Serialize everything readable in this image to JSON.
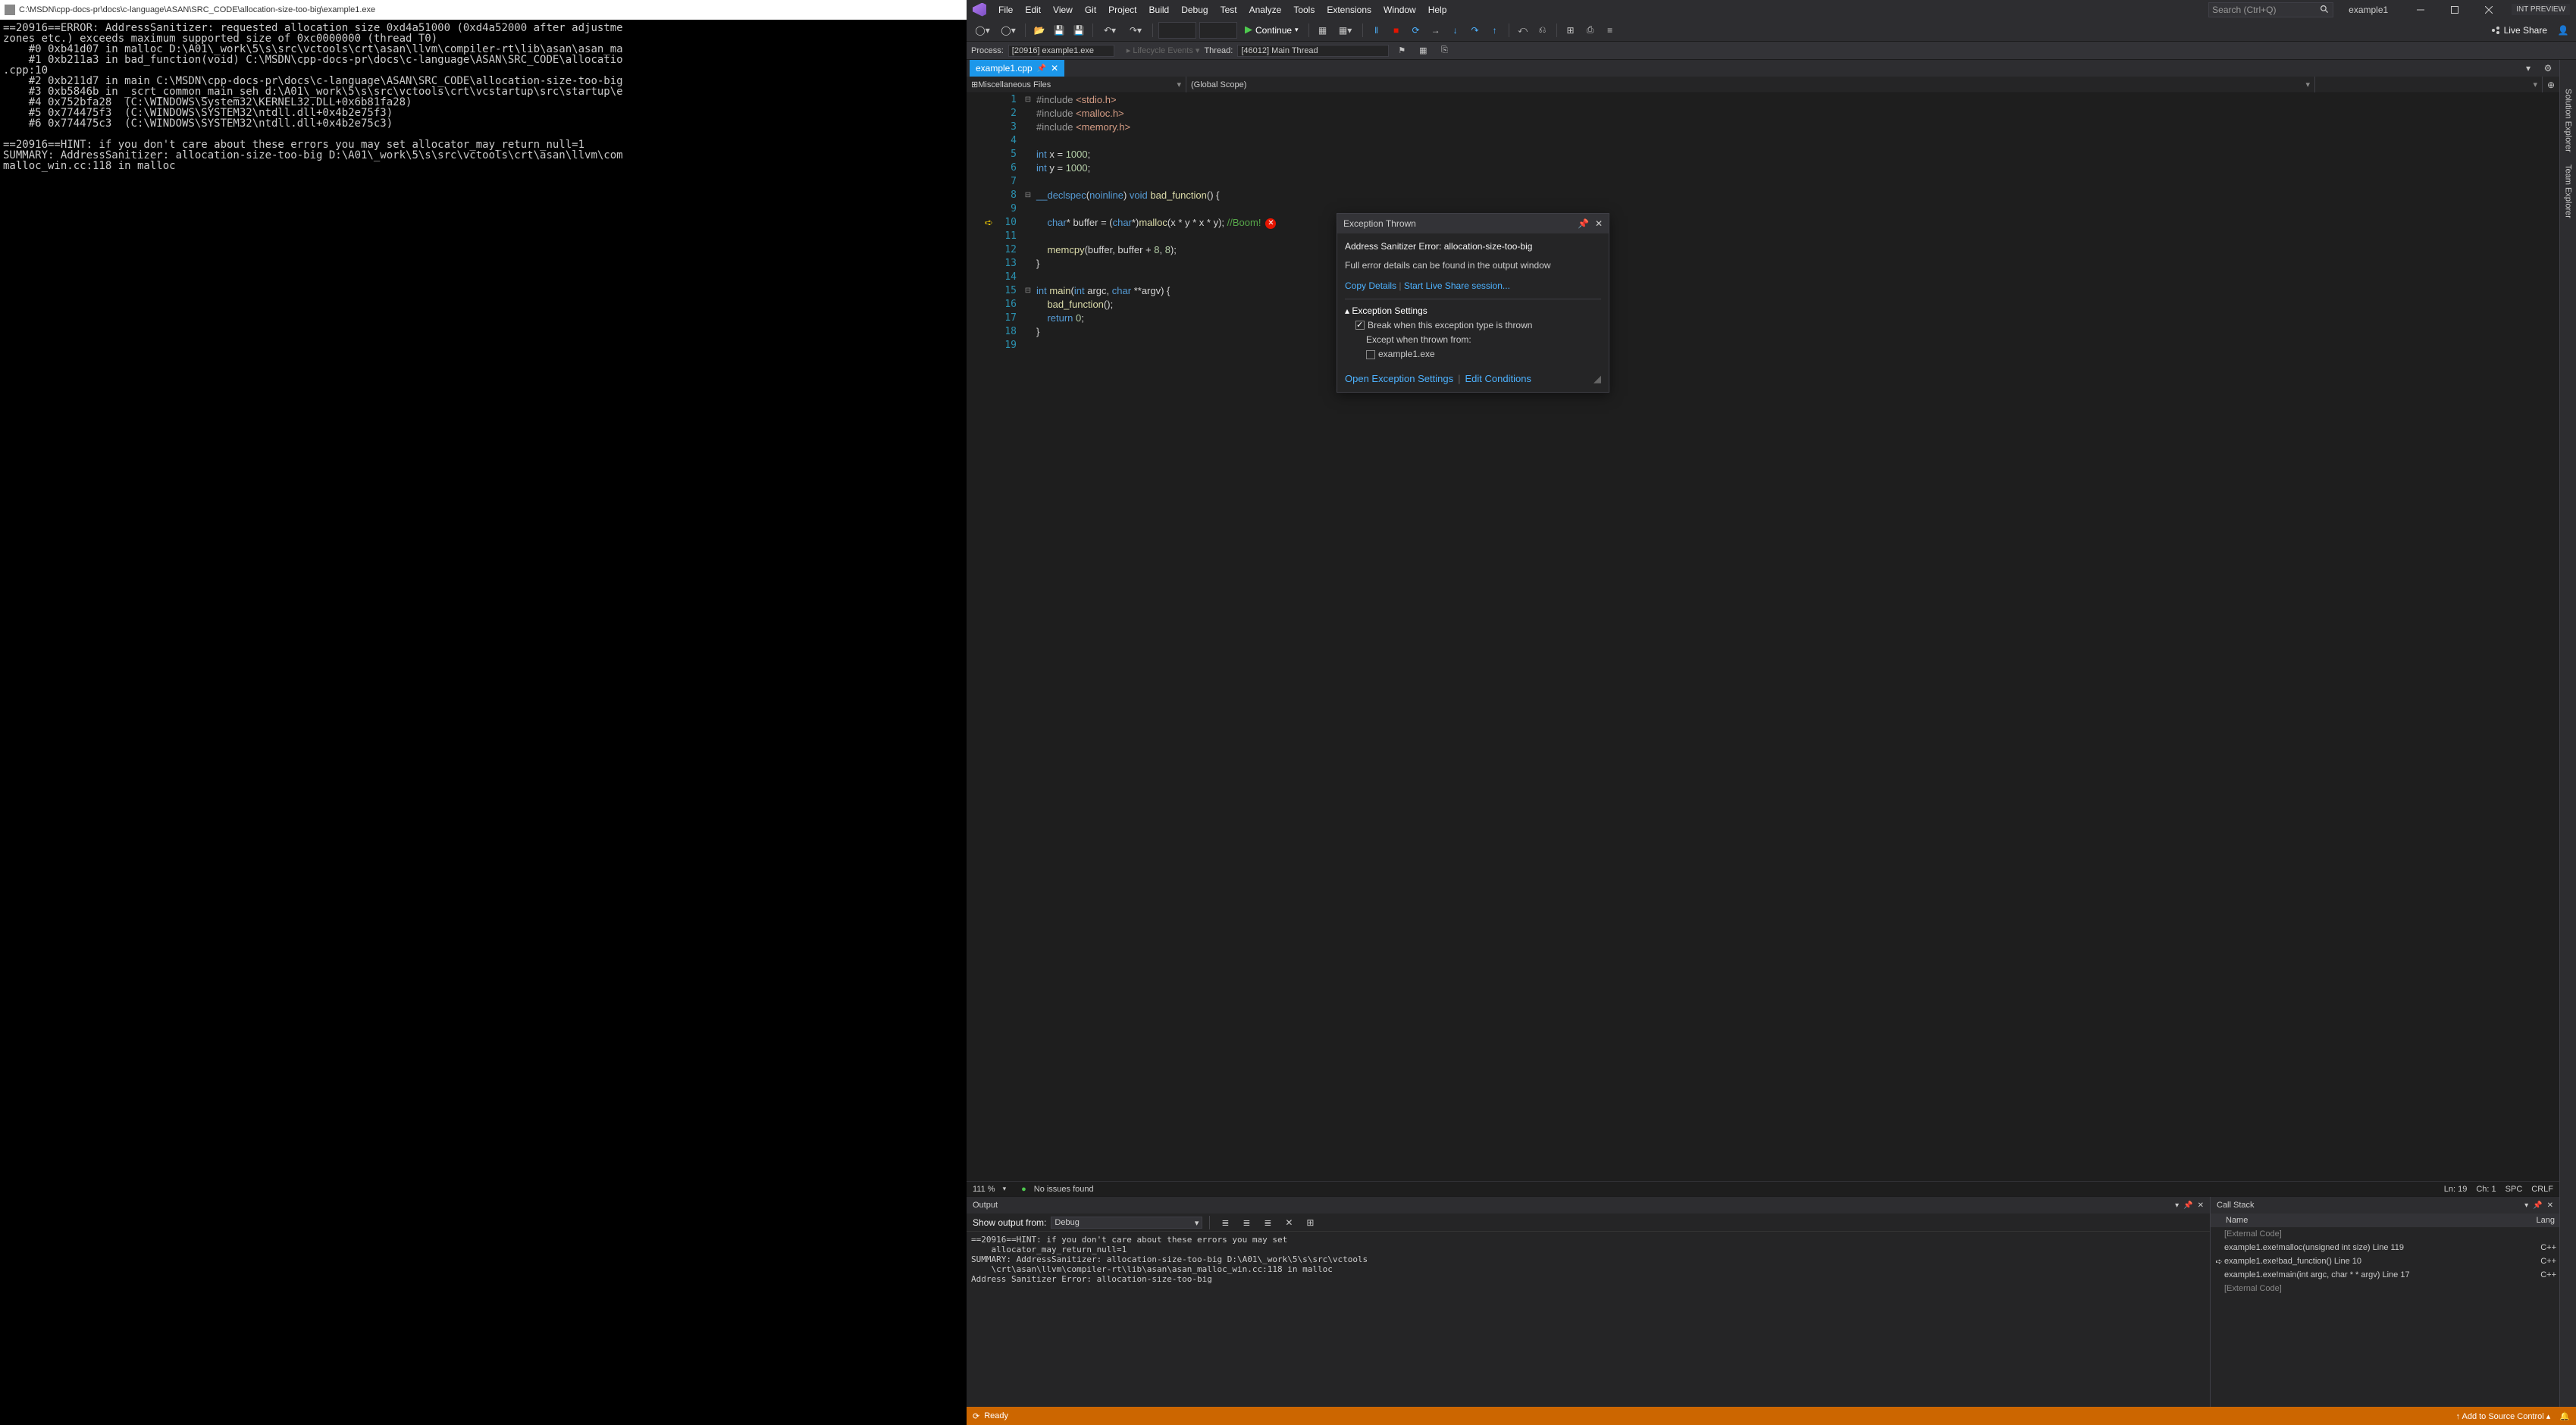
{
  "console": {
    "title": "C:\\MSDN\\cpp-docs-pr\\docs\\c-language\\ASAN\\SRC_CODE\\allocation-size-too-big\\example1.exe",
    "lines": [
      "==20916==ERROR: AddressSanitizer: requested allocation size 0xd4a51000 (0xd4a52000 after adjustme",
      "zones etc.) exceeds maximum supported size of 0xc0000000 (thread T0)",
      "    #0 0xb41d07 in malloc D:\\A01\\_work\\5\\s\\src\\vctools\\crt\\asan\\llvm\\compiler-rt\\lib\\asan\\asan_ma",
      "    #1 0xb211a3 in bad_function(void) C:\\MSDN\\cpp-docs-pr\\docs\\c-language\\ASAN\\SRC_CODE\\allocatio",
      ".cpp:10",
      "    #2 0xb211d7 in main C:\\MSDN\\cpp-docs-pr\\docs\\c-language\\ASAN\\SRC_CODE\\allocation-size-too-big",
      "    #3 0xb5846b in _scrt_common_main_seh d:\\A01\\_work\\5\\s\\src\\vctools\\crt\\vcstartup\\src\\startup\\e",
      "    #4 0x752bfa28  (C:\\WINDOWS\\System32\\KERNEL32.DLL+0x6b81fa28)",
      "    #5 0x774475f3  (C:\\WINDOWS\\SYSTEM32\\ntdll.dll+0x4b2e75f3)",
      "    #6 0x774475c3  (C:\\WINDOWS\\SYSTEM32\\ntdll.dll+0x4b2e75c3)",
      "",
      "==20916==HINT: if you don't care about these errors you may set allocator_may_return_null=1",
      "SUMMARY: AddressSanitizer: allocation-size-too-big D:\\A01\\_work\\5\\s\\src\\vctools\\crt\\asan\\llvm\\com",
      "malloc_win.cc:118 in malloc"
    ]
  },
  "menu": [
    "File",
    "Edit",
    "View",
    "Git",
    "Project",
    "Build",
    "Debug",
    "Test",
    "Analyze",
    "Tools",
    "Extensions",
    "Window",
    "Help"
  ],
  "search_placeholder": "Search (Ctrl+Q)",
  "solution_name": "example1",
  "int_preview": "INT PREVIEW",
  "continue_label": "Continue",
  "live_share": "Live Share",
  "process_label": "Process:",
  "process_value": "[20916] example1.exe",
  "lifecycle": "Lifecycle Events",
  "thread_label": "Thread:",
  "thread_value": "[46012] Main Thread",
  "tab_name": "example1.cpp",
  "nav1": "Miscellaneous Files",
  "nav2": "(Global Scope)",
  "code": {
    "lines": 19,
    "zoom": "111 %",
    "issues": "No issues found",
    "ln": "Ln: 19",
    "ch": "Ch: 1",
    "spc": "SPC",
    "crlf": "CRLF"
  },
  "exception": {
    "title": "Exception Thrown",
    "error": "Address Sanitizer Error: allocation-size-too-big",
    "detail": "Full error details can be found in the output window",
    "copy": "Copy Details",
    "start_share": "Start Live Share session...",
    "settings_hd": "Exception Settings",
    "break_label": "Break when this exception type is thrown",
    "except_label": "Except when thrown from:",
    "exe": "example1.exe",
    "open_settings": "Open Exception Settings",
    "edit_cond": "Edit Conditions"
  },
  "output": {
    "title": "Output",
    "show_from": "Show output from:",
    "source": "Debug",
    "body": "==20916==HINT: if you don't care about these errors you may set\n    allocator_may_return_null=1\nSUMMARY: AddressSanitizer: allocation-size-too-big D:\\A01\\_work\\5\\s\\src\\vctools\n    \\crt\\asan\\llvm\\compiler-rt\\lib\\asan\\asan_malloc_win.cc:118 in malloc\nAddress Sanitizer Error: allocation-size-too-big"
  },
  "callstack": {
    "title": "Call Stack",
    "col_name": "Name",
    "col_lang": "Lang",
    "rows": [
      {
        "name": "[External Code]",
        "lang": "",
        "ext": true,
        "ic": ""
      },
      {
        "name": "example1.exe!malloc(unsigned int size) Line 119",
        "lang": "C++",
        "ext": false,
        "ic": ""
      },
      {
        "name": "example1.exe!bad_function() Line 10",
        "lang": "C++",
        "ext": false,
        "ic": "➪"
      },
      {
        "name": "example1.exe!main(int argc, char * * argv) Line 17",
        "lang": "C++",
        "ext": false,
        "ic": ""
      },
      {
        "name": "[External Code]",
        "lang": "",
        "ext": true,
        "ic": ""
      }
    ]
  },
  "side_tabs": [
    "Solution Explorer",
    "Team Explorer"
  ],
  "status": {
    "ready": "Ready",
    "add_src": "Add to Source Control"
  }
}
